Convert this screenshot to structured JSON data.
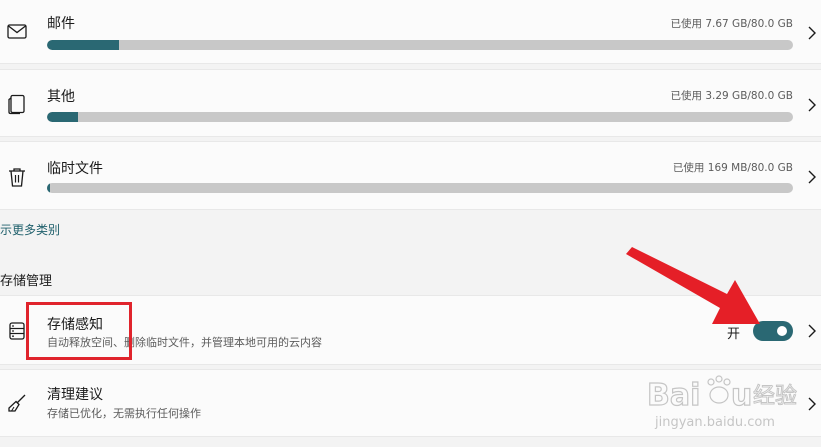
{
  "categories": [
    {
      "title": "邮件",
      "usage": "已使用 7.67 GB/80.0 GB",
      "fraction": 0.0959,
      "icon": "mail-icon"
    },
    {
      "title": "其他",
      "usage": "已使用 3.29 GB/80.0 GB",
      "fraction": 0.0411,
      "icon": "other-files-icon"
    },
    {
      "title": "临时文件",
      "usage": "已使用 169 MB/80.0 GB",
      "fraction": 0.0021,
      "icon": "trash-icon"
    }
  ],
  "show_more_link": "示更多类别",
  "storage_management": {
    "heading": "存储管理",
    "storage_sense": {
      "title": "存储感知",
      "subtitle": "自动释放空间、删除临时文件，并管理本地可用的云内容",
      "toggle_label": "开",
      "toggle_on": true,
      "icon": "storage-sense-icon"
    },
    "cleanup": {
      "title": "清理建议",
      "subtitle": "存储已优化，无需执行任何操作",
      "icon": "broom-icon"
    }
  },
  "watermark": {
    "logo_text": "Baidu经验",
    "url_text": "jingyan.baidu.com"
  },
  "colors": {
    "accent": "#2a6873",
    "bar_track": "#c8c8c8",
    "highlight": "#e0242c",
    "page_bg": "#f3f3f3",
    "card_bg": "#fbfbfb"
  }
}
